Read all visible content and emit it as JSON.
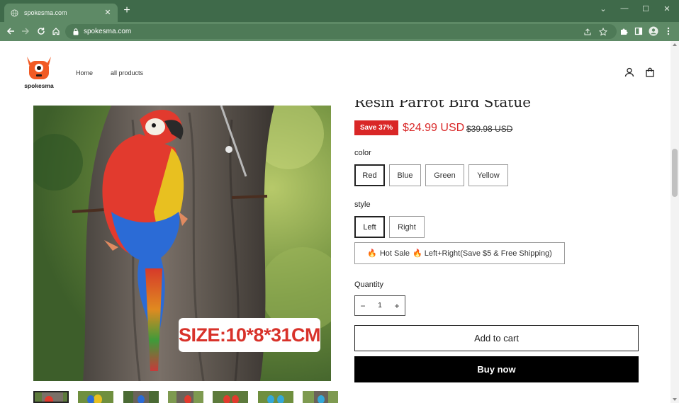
{
  "browser": {
    "tab_title": "spokesma.com",
    "url": "spokesma.com",
    "accent_color": "#3f6a4a"
  },
  "site": {
    "logo_text": "spokesma",
    "nav": [
      {
        "label": "Home"
      },
      {
        "label": "all products"
      }
    ],
    "logo_color": "#f15a24"
  },
  "product": {
    "title": "Resin Parrot Bird Statue",
    "image_caption": "SIZE:10*8*31CM",
    "badge": "Save 37%",
    "price": "$24.99 USD",
    "compare_price": "$39.98 USD",
    "sale_color": "#d92727",
    "thumbnail_count": 7,
    "selected_thumbnail": 1
  },
  "options": {
    "color_label": "color",
    "colors": [
      "Red",
      "Blue",
      "Green",
      "Yellow"
    ],
    "selected_color": "Red",
    "style_label": "style",
    "styles": [
      "Left",
      "Right"
    ],
    "selected_style": "Left",
    "bundle_label": "Hot Sale",
    "bundle_text": "Left+Right(Save $5 & Free Shipping)"
  },
  "quantity": {
    "label": "Quantity",
    "value": "1",
    "minus": "−",
    "plus": "+"
  },
  "actions": {
    "add_to_cart": "Add to cart",
    "buy_now": "Buy now"
  }
}
